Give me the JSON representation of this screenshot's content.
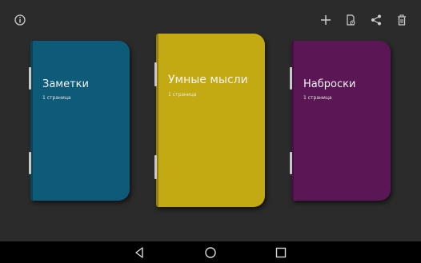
{
  "toolbar": {
    "icons": [
      "info-icon",
      "add-icon",
      "note-settings-icon",
      "share-icon",
      "delete-icon"
    ]
  },
  "notebooks": [
    {
      "title": "Заметки",
      "pages": "1 страница",
      "color": "#0e5a79"
    },
    {
      "title": "Умные мысли",
      "pages": "1 страница",
      "color": "#c4aa12"
    },
    {
      "title": "Наброски",
      "pages": "1 страница",
      "color": "#5b1655"
    }
  ],
  "navigation": {
    "icons": [
      "back-icon",
      "home-icon",
      "recents-icon"
    ]
  }
}
